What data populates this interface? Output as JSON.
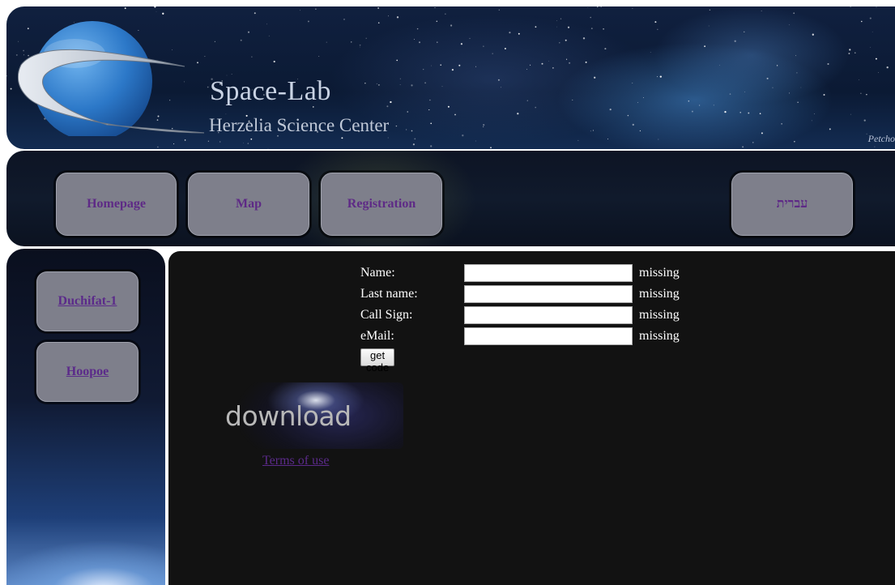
{
  "header": {
    "title": "Space-Lab",
    "subtitle": "Herzelia Science Center",
    "signature": "Petcho"
  },
  "nav": {
    "items": [
      {
        "label": "Homepage"
      },
      {
        "label": "Map"
      },
      {
        "label": "Registration"
      },
      {
        "label": "עברית"
      }
    ]
  },
  "sidebar": {
    "items": [
      {
        "label": "Duchifat-1"
      },
      {
        "label": "Hoopoe"
      }
    ]
  },
  "form": {
    "fields": [
      {
        "label": "Name:",
        "value": "",
        "status": "missing"
      },
      {
        "label": "Last name:",
        "value": "",
        "status": "missing"
      },
      {
        "label": "Call Sign:",
        "value": "",
        "status": "missing"
      },
      {
        "label": "eMail:",
        "value": "",
        "status": "missing"
      }
    ],
    "submit_label": "get code"
  },
  "download": {
    "label": "download",
    "terms_link": "Terms of use"
  },
  "colors": {
    "button_bg": "#7e7f8b",
    "nav_text": "#5e2a86",
    "link": "#5b2a8a",
    "content_bg": "#121212"
  }
}
